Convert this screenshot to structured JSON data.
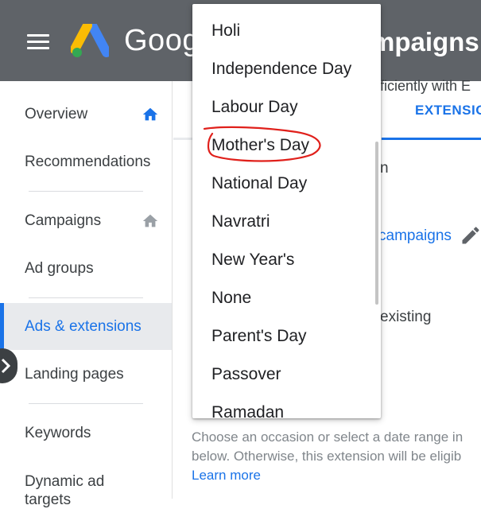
{
  "header": {
    "brand": "Goog",
    "title": "mpaigns",
    "colors": {
      "background": "#5f6368",
      "text": "#ffffff"
    }
  },
  "sidebar": {
    "items": [
      {
        "label": "Overview",
        "icon": "home-icon",
        "icon_color": "#1a73e8"
      },
      {
        "label": "Recommendations"
      },
      {
        "label": "Campaigns",
        "icon": "home-icon",
        "icon_color": "#9aa0a6"
      },
      {
        "label": "Ad groups"
      },
      {
        "label": "Ads & extensions",
        "active": true
      },
      {
        "label": "Landing pages"
      },
      {
        "label": "Keywords"
      },
      {
        "label": "Dynamic ad"
      },
      {
        "label": "targets"
      }
    ],
    "accent_color": "#1a73e8"
  },
  "main": {
    "subtitle_fragment": "ficiently with E",
    "tab_label": "EXTENSIO",
    "line1_fragment": "n",
    "campaigns_link": "campaigns",
    "existing_fragment": "existing",
    "help_line1": "Choose an occasion or select a date range in",
    "help_line2": "below. Otherwise, this extension will be eligib",
    "learn_more": "Learn more"
  },
  "dropdown": {
    "options": [
      "Holi",
      "Independence Day",
      "Labour Day",
      "Mother's Day",
      "National Day",
      "Navratri",
      "New Year's",
      "None",
      "Parent's Day",
      "Passover",
      "Ramadan"
    ],
    "highlighted": "Mother's Day",
    "highlight_color": "#e0201b"
  }
}
